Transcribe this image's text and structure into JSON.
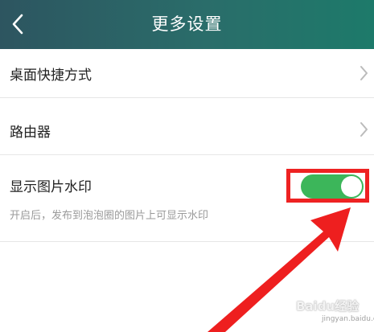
{
  "header": {
    "title": "更多设置",
    "back_icon": "chevron-left-icon"
  },
  "settings": {
    "desktop_shortcut": {
      "label": "桌面快捷方式"
    },
    "router": {
      "label": "路由器"
    },
    "watermark": {
      "label": "显示图片水印",
      "description": "开启后，发布到泡泡圈的图片上可显示水印",
      "enabled": true
    }
  },
  "colors": {
    "header_start": "#2d5560",
    "header_end": "#1d7a6a",
    "toggle_on": "#3cb65a",
    "annotation": "#ee2222"
  },
  "overlay": {
    "watermark_text": "Baidu经验",
    "watermark_sub": "jingyan.baidu.com"
  }
}
